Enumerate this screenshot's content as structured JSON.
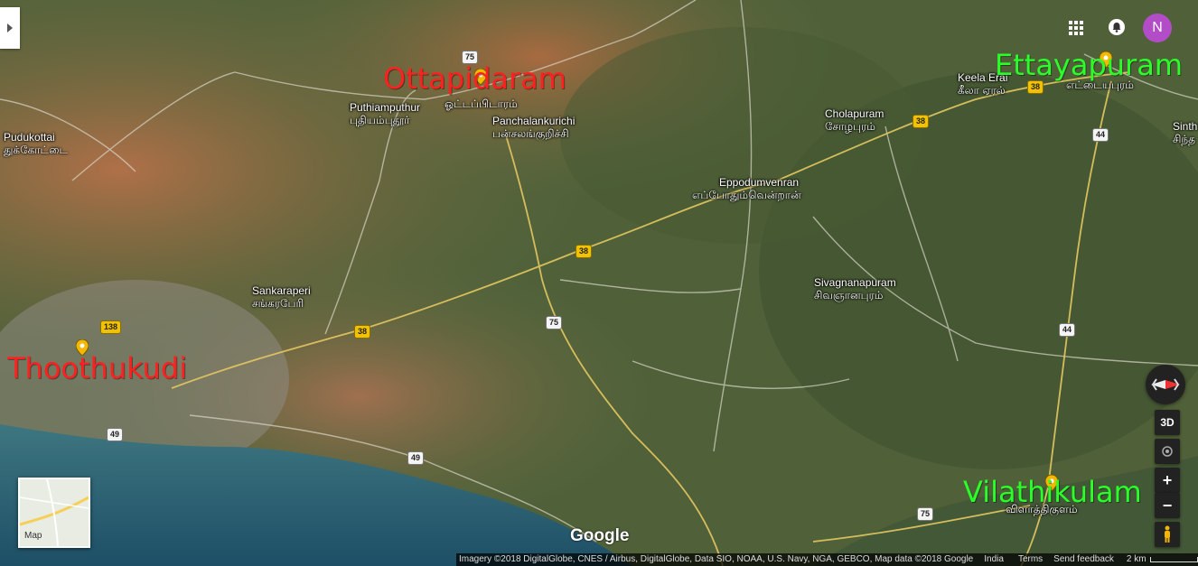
{
  "place_labels": [
    {
      "en": "Pudukottai",
      "ta": "துக்கோட்டை"
    },
    {
      "en": "Puthiamputhur",
      "ta": "புதியம்புதூர்"
    },
    {
      "en": "",
      "ta": "ஓட்டப்பிடாரம்"
    },
    {
      "en": "Panchalankurichi",
      "ta": "பன்சலங்குறிச்சி"
    },
    {
      "en": "Cholapuram",
      "ta": "சோழபுரம்"
    },
    {
      "en": "Keela Erai",
      "ta": "கீலா ஏரல்"
    },
    {
      "en": "",
      "ta": "எட்டையபுரம்"
    },
    {
      "en": "Sinth",
      "ta": "சிந்த"
    },
    {
      "en": "Eppodumvenran",
      "ta": "எப்போதும்வென்றான்"
    },
    {
      "en": "Sivagnanapuram",
      "ta": "சிவஞானபுரம்"
    },
    {
      "en": "Sankaraperi",
      "ta": "சங்கரபேரி"
    },
    {
      "en": "",
      "ta": "விளாத்திகுளம்"
    }
  ],
  "annotations": {
    "ottapidaram": "Ottapidaram",
    "ettayapuram": "Ettayapuram",
    "thoothukudi": "Thoothukudi",
    "vilathikulam": "Vilathikulam"
  },
  "road_shields": [
    "75",
    "38",
    "38",
    "44",
    "38",
    "75",
    "138",
    "38",
    "44",
    "49",
    "49",
    "75"
  ],
  "controls": {
    "three_d": "3D",
    "zoom_in": "+",
    "zoom_out": "−",
    "avatar_initial": "N",
    "minimap_label": "Map",
    "google_logo": "Google"
  },
  "footer": {
    "imagery": "Imagery ©2018 DigitalGlobe, CNES / Airbus, DigitalGlobe, Data SIO, NOAA, U.S. Navy, NGA, GEBCO, Map data ©2018 Google",
    "country": "India",
    "terms": "Terms",
    "feedback": "Send feedback",
    "scale": "2 km"
  },
  "colors": {
    "red_annotation": "#ff2020",
    "green_annotation": "#2aff2a",
    "road_shield": "#f2c200",
    "avatar": "#b34cc7"
  }
}
